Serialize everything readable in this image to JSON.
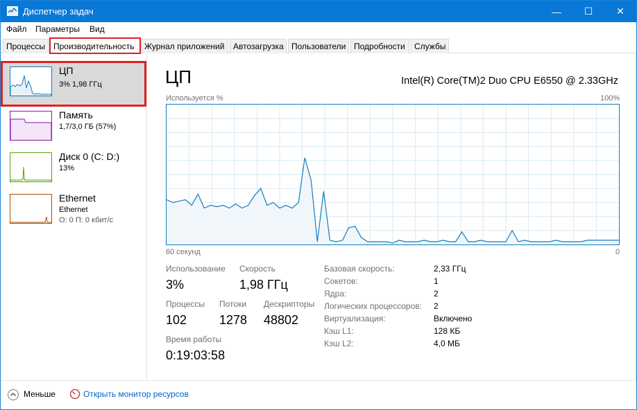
{
  "window": {
    "title": "Диспетчер задач",
    "minimize_glyph": "—",
    "maximize_glyph": "☐",
    "close_glyph": "✕"
  },
  "menu": [
    "Файл",
    "Параметры",
    "Вид"
  ],
  "tabs": [
    "Процессы",
    "Производительность",
    "Журнал приложений",
    "Автозагрузка",
    "Пользователи",
    "Подробности",
    "Службы"
  ],
  "active_tab": "Производительность",
  "sidebar": {
    "items": [
      {
        "title": "ЦП",
        "line1": "3% 1,98 ГГц",
        "line2": "",
        "color": "#117dbb",
        "selected": true
      },
      {
        "title": "Память",
        "line1": "1,7/3,0 ГБ (57%)",
        "line2": "",
        "color": "#8b12ae",
        "selected": false
      },
      {
        "title": "Диск 0 (C: D:)",
        "line1": "13%",
        "line2": "",
        "color": "#4da60c",
        "selected": false
      },
      {
        "title": "Ethernet",
        "line1": "Ethernet",
        "line2": "О: 0 П: 0 кбит/с",
        "color": "#a74f01",
        "selected": false
      }
    ]
  },
  "main": {
    "title": "ЦП",
    "cpu_name": "Intel(R) Core(TM)2 Duo CPU E6550 @ 2.33GHz",
    "graph_ylabel": "Используется %",
    "graph_ymax": "100%",
    "graph_xlabel": "60 секунд",
    "graph_xmin": "0",
    "utilization_percent": [
      32,
      30,
      31,
      32,
      28,
      36,
      26,
      28,
      27,
      28,
      26,
      29,
      26,
      28,
      35,
      40,
      28,
      30,
      26,
      28,
      26,
      30,
      62,
      46,
      2,
      38,
      3,
      2,
      3,
      12,
      13,
      5,
      2,
      2,
      2,
      2,
      1,
      3,
      2,
      2,
      2,
      3,
      2,
      2,
      3,
      2,
      2,
      9,
      2,
      2,
      3,
      2,
      2,
      2,
      2,
      10,
      2,
      3,
      2,
      2,
      2,
      2,
      3,
      2,
      2,
      2,
      2,
      3,
      3,
      3,
      3,
      3,
      3
    ]
  },
  "stats": {
    "utilization_label": "Использование",
    "utilization_value": "3%",
    "speed_label": "Скорость",
    "speed_value": "1,98 ГГц",
    "processes_label": "Процессы",
    "processes_value": "102",
    "threads_label": "Потоки",
    "threads_value": "1278",
    "handles_label": "Дескрипторы",
    "handles_value": "48802",
    "uptime_label": "Время работы",
    "uptime_value": "0:19:03:58"
  },
  "properties": [
    {
      "label": "Базовая скорость:",
      "value": "2,33 ГГц"
    },
    {
      "label": "Сокетов:",
      "value": "1"
    },
    {
      "label": "Ядра:",
      "value": "2"
    },
    {
      "label": "Логических процессоров:",
      "value": "2"
    },
    {
      "label": "Виртуализация:",
      "value": "Включено"
    },
    {
      "label": "Кэш L1:",
      "value": "128 КБ"
    },
    {
      "label": "Кэш L2:",
      "value": "4,0 МБ"
    }
  ],
  "footer": {
    "fewer_label": "Меньше",
    "resource_monitor_label": "Открыть монитор ресурсов"
  },
  "colors": {
    "cpu_line": "#117dbb",
    "cpu_fill": "#f1f6fa",
    "grid": "#d9eaf4",
    "highlight": "#e02020",
    "titlebar": "#0a78d7"
  }
}
